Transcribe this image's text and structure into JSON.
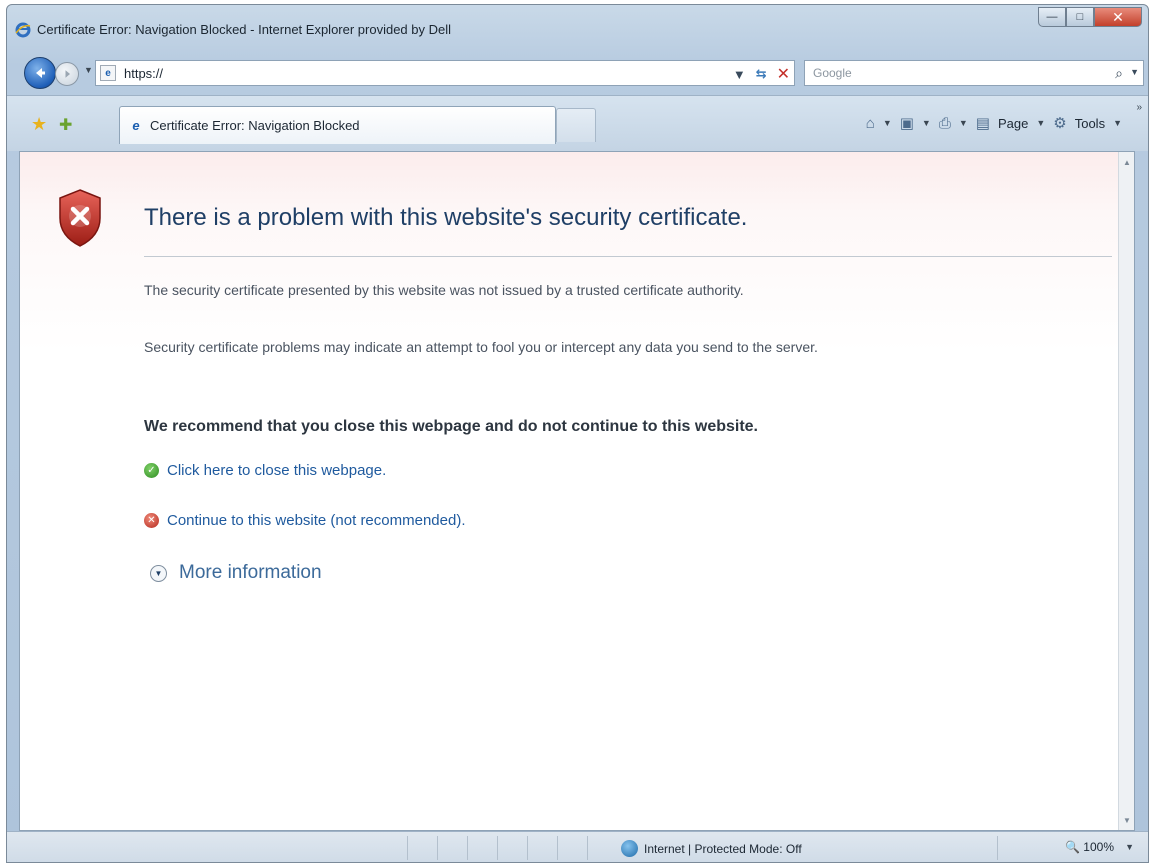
{
  "window": {
    "title": "Certificate Error: Navigation Blocked - Internet Explorer provided by Dell",
    "controls": {
      "minimize": "—",
      "maximize": "□",
      "close": "✕"
    }
  },
  "navbar": {
    "address": "https://",
    "address_icon": "page-icon",
    "search_placeholder": "Google",
    "back_icon": "back-arrow-icon",
    "forward_icon": "forward-arrow-icon",
    "refresh_glyph": "⇆",
    "stop_glyph": "✕",
    "search_glyph": "⌕",
    "dropdown_glyph": "▼"
  },
  "cmdbar": {
    "tab_label": "Certificate Error: Navigation Blocked",
    "page_label": "Page",
    "tools_label": "Tools",
    "home_glyph": "⌂",
    "feeds_glyph": "▣",
    "print_glyph": "⎙",
    "page_glyph": "▤",
    "tools_glyph": "⚙",
    "dropdown_glyph": "▼",
    "chevron_glyph": "»"
  },
  "content": {
    "heading": "There is a problem with this website's security certificate.",
    "paragraph1": "The security certificate presented by this website was not issued by a trusted certificate authority.",
    "paragraph2": "Security certificate problems may indicate an attempt to fool you or intercept any data you send to the server.",
    "recommendation": "We recommend that you close this webpage and do not continue to this website.",
    "close_link": "Click here to close this webpage.",
    "continue_link": "Continue to this website (not recommended).",
    "more_info": "More information",
    "colors": {
      "heading": "#1f3f66",
      "link": "#1f5a9e",
      "shield": "#b3281d"
    }
  },
  "statusbar": {
    "zone": "Internet | Protected Mode: Off",
    "zoom": "100%",
    "zoom_glyph": "🔍"
  }
}
